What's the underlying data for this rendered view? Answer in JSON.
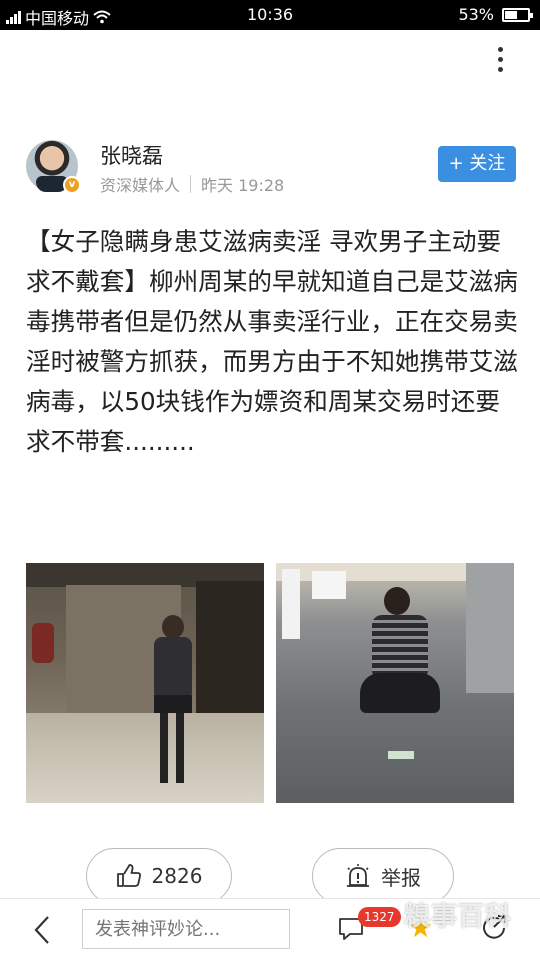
{
  "status_bar": {
    "carrier": "中国移动",
    "time": "10:36",
    "battery_percent": "53%",
    "battery_level": 0.53
  },
  "author": {
    "name": "张晓磊",
    "title": "资深媒体人",
    "time": "昨天 19:28",
    "follow_label": "+ 关注"
  },
  "article": {
    "text": "【女子隐瞒身患艾滋病卖淫 寻欢男子主动要求不戴套】柳州周某的早就知道自己是艾滋病毒携带者但是仍然从事卖淫行业，正在交易卖淫时被警方抓获，而男方由于不知她携带艾滋病毒，以50块钱作为嫖资和周某交易时还要求不带套........."
  },
  "actions": {
    "like_count": "2826",
    "report_label": "举报"
  },
  "bottom_bar": {
    "comment_placeholder": "发表神评妙论...",
    "comment_count": "1327",
    "watermark": "糗事百科"
  },
  "icons": {
    "more": "more-vertical-icon",
    "like": "thumbs-up-icon",
    "report": "report-icon",
    "back": "back-arrow-icon",
    "comment": "comment-icon",
    "star": "star-icon",
    "share": "share-icon"
  },
  "colors": {
    "follow_button": "#3b8fe0",
    "badge": "#e8372c",
    "star": "#f4b400"
  }
}
